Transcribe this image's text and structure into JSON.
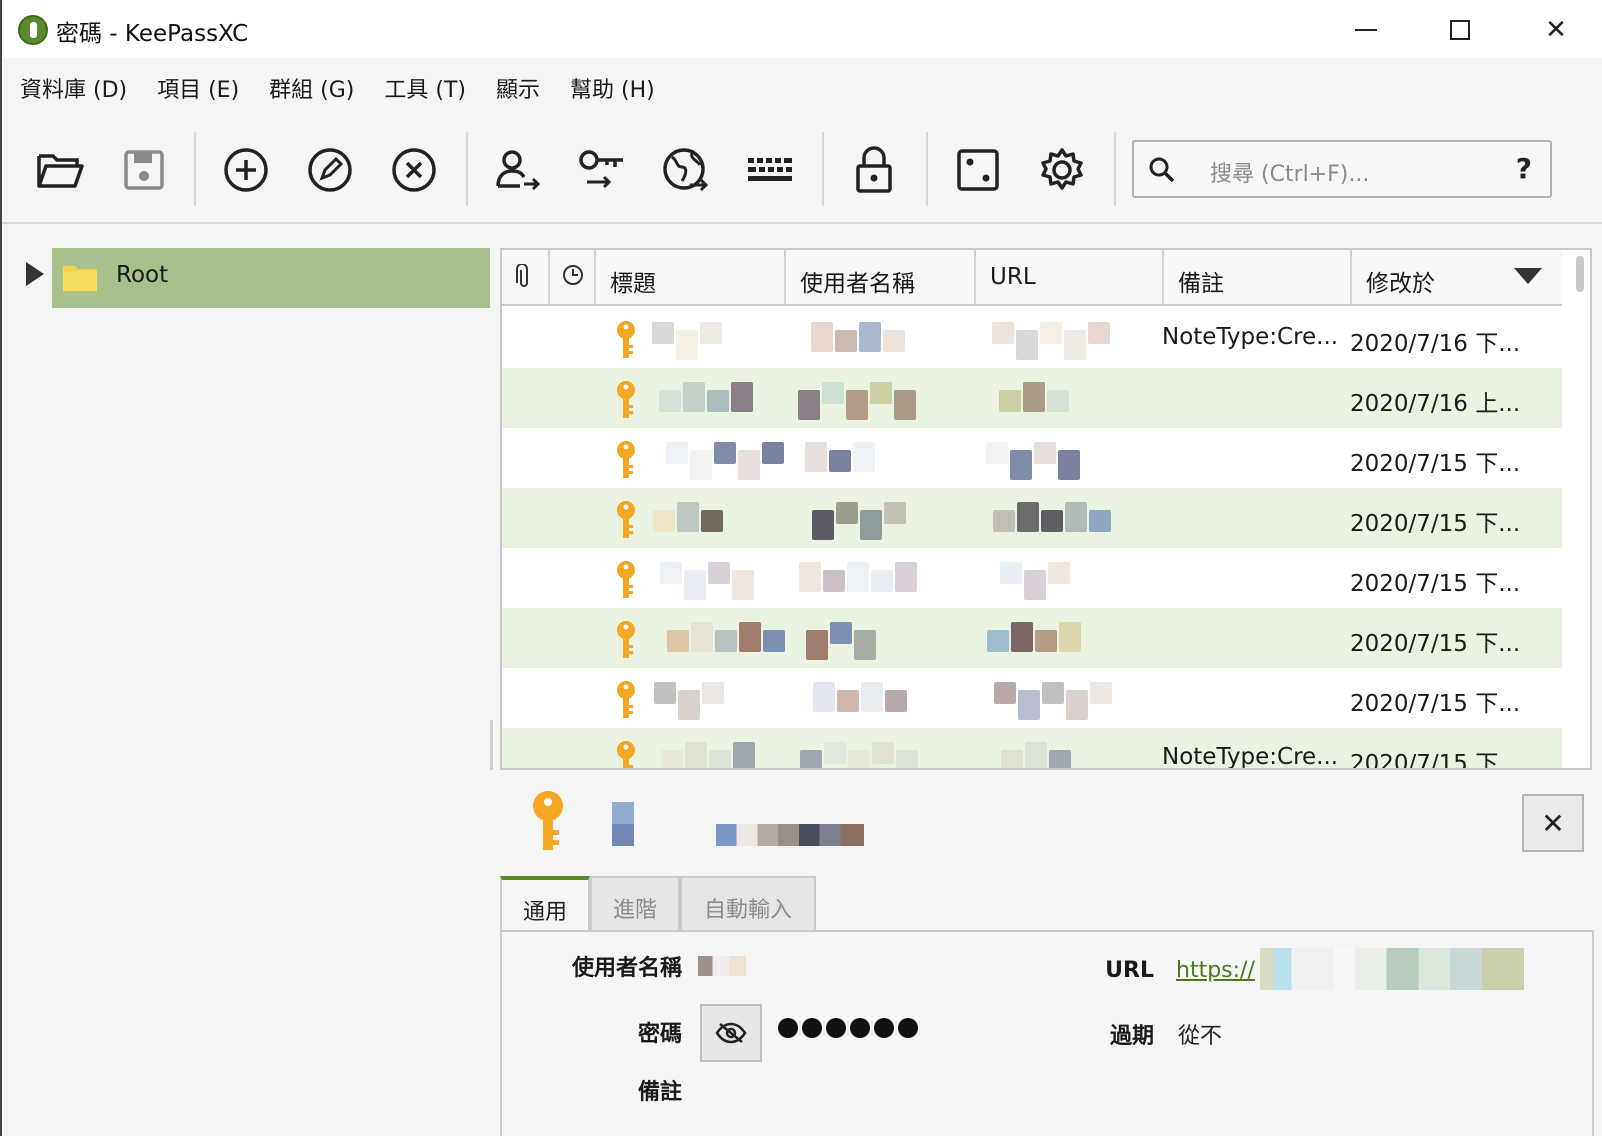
{
  "window": {
    "title": "密碼 - KeePassXC",
    "minimize_label": "",
    "maximize_label": "",
    "close_label": "✕"
  },
  "menu": [
    "資料庫 (D)",
    "項目 (E)",
    "群組 (G)",
    "工具 (T)",
    "顯示",
    "幫助 (H)"
  ],
  "toolbar": {
    "buttons": [
      "open-database",
      "save-database",
      "add-entry",
      "edit-entry",
      "delete-entry",
      "copy-username",
      "copy-password",
      "open-url",
      "auto-type",
      "lock-database",
      "password-generator",
      "settings"
    ],
    "search_placeholder": "搜尋 (Ctrl+F)...",
    "help_label": "?"
  },
  "groups": {
    "root_label": "Root"
  },
  "table": {
    "columns": [
      "",
      "",
      "標題",
      "使用者名稱",
      "URL",
      "備註",
      "修改於"
    ],
    "rows": [
      {
        "notes": "NoteType:Cre...",
        "modified": "2020/7/16 下..."
      },
      {
        "notes": "",
        "modified": "2020/7/16 上..."
      },
      {
        "notes": "",
        "modified": "2020/7/15 下..."
      },
      {
        "notes": "",
        "modified": "2020/7/15 下..."
      },
      {
        "notes": "",
        "modified": "2020/7/15 下..."
      },
      {
        "notes": "",
        "modified": "2020/7/15 下..."
      },
      {
        "notes": "",
        "modified": "2020/7/15 下..."
      },
      {
        "notes": "NoteType:Cre...",
        "modified": "2020/7/15 下..."
      }
    ]
  },
  "preview": {
    "close_label": "✕",
    "tabs": [
      "通用",
      "進階",
      "自動輸入"
    ],
    "labels": {
      "username": "使用者名稱",
      "password": "密碼",
      "notes": "備註",
      "url": "URL",
      "expires": "過期"
    },
    "url_prefix": "https://",
    "expires_value": "從不"
  },
  "colors": {
    "accent": "#5a8a28",
    "selection": "#a8c08c",
    "row_alt": "#eaf2e2",
    "key_icon": "#f5a623"
  }
}
